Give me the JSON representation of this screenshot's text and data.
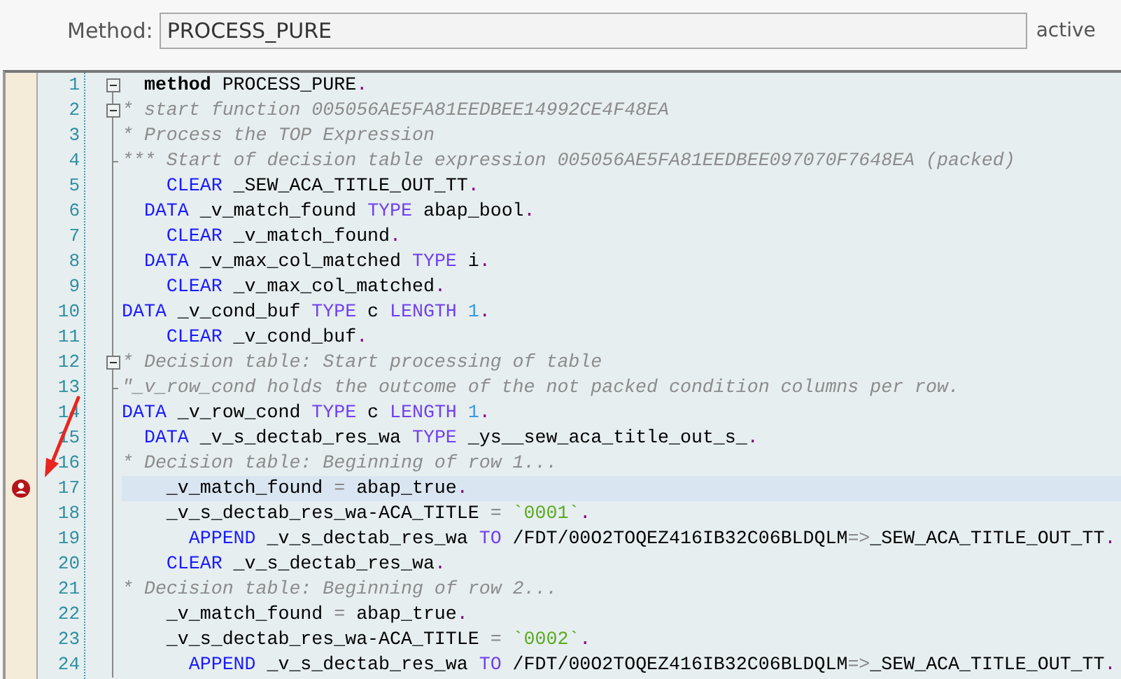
{
  "header": {
    "label": "Method:",
    "value": "PROCESS_PURE",
    "status": "active"
  },
  "lines": [
    {
      "number": "1",
      "collapsible": true,
      "block_end": false,
      "current": false,
      "breakpoint": false,
      "tokens": [
        {
          "kind": "bold",
          "t": "  method"
        },
        {
          "kind": "plain",
          "t": " PROCESS_PURE"
        },
        {
          "kind": "dot",
          "t": "."
        }
      ]
    },
    {
      "number": "2",
      "collapsible": true,
      "block_end": false,
      "current": false,
      "breakpoint": false,
      "tokens": [
        {
          "kind": "comment",
          "t": "* start function 005056AE5FA81EEDBEE14992CE4F48EA"
        }
      ]
    },
    {
      "number": "3",
      "collapsible": false,
      "block_end": false,
      "current": false,
      "breakpoint": false,
      "tokens": [
        {
          "kind": "comment",
          "t": "* Process the TOP Expression"
        }
      ]
    },
    {
      "number": "4",
      "collapsible": false,
      "block_end": true,
      "current": false,
      "breakpoint": false,
      "tokens": [
        {
          "kind": "comment",
          "t": "*** Start of decision table expression 005056AE5FA81EEDBEE097070F7648EA (packed)"
        }
      ]
    },
    {
      "number": "5",
      "collapsible": false,
      "block_end": false,
      "current": false,
      "breakpoint": false,
      "tokens": [
        {
          "kind": "keyword",
          "t": "    CLEAR"
        },
        {
          "kind": "plain",
          "t": " _SEW_ACA_TITLE_OUT_TT"
        },
        {
          "kind": "dot",
          "t": "."
        }
      ]
    },
    {
      "number": "6",
      "collapsible": false,
      "block_end": false,
      "current": false,
      "breakpoint": false,
      "tokens": [
        {
          "kind": "keyword",
          "t": "  DATA"
        },
        {
          "kind": "plain",
          "t": " _v_match_found "
        },
        {
          "kind": "addition",
          "t": "TYPE"
        },
        {
          "kind": "plain",
          "t": " abap_bool"
        },
        {
          "kind": "dot",
          "t": "."
        }
      ]
    },
    {
      "number": "7",
      "collapsible": false,
      "block_end": false,
      "current": false,
      "breakpoint": false,
      "tokens": [
        {
          "kind": "keyword",
          "t": "    CLEAR"
        },
        {
          "kind": "plain",
          "t": " _v_match_found"
        },
        {
          "kind": "dot",
          "t": "."
        }
      ]
    },
    {
      "number": "8",
      "collapsible": false,
      "block_end": false,
      "current": false,
      "breakpoint": false,
      "tokens": [
        {
          "kind": "keyword",
          "t": "  DATA"
        },
        {
          "kind": "plain",
          "t": " _v_max_col_matched "
        },
        {
          "kind": "addition",
          "t": "TYPE"
        },
        {
          "kind": "plain",
          "t": " i"
        },
        {
          "kind": "dot",
          "t": "."
        }
      ]
    },
    {
      "number": "9",
      "collapsible": false,
      "block_end": false,
      "current": false,
      "breakpoint": false,
      "tokens": [
        {
          "kind": "keyword",
          "t": "    CLEAR"
        },
        {
          "kind": "plain",
          "t": " _v_max_col_matched"
        },
        {
          "kind": "dot",
          "t": "."
        }
      ]
    },
    {
      "number": "10",
      "collapsible": false,
      "block_end": false,
      "current": false,
      "breakpoint": false,
      "tokens": [
        {
          "kind": "keyword",
          "t": "DATA"
        },
        {
          "kind": "plain",
          "t": " _v_cond_buf "
        },
        {
          "kind": "addition",
          "t": "TYPE"
        },
        {
          "kind": "plain",
          "t": " c "
        },
        {
          "kind": "addition",
          "t": "LENGTH"
        },
        {
          "kind": "number",
          "t": " 1"
        },
        {
          "kind": "dot",
          "t": "."
        }
      ]
    },
    {
      "number": "11",
      "collapsible": false,
      "block_end": false,
      "current": false,
      "breakpoint": false,
      "tokens": [
        {
          "kind": "keyword",
          "t": "    CLEAR"
        },
        {
          "kind": "plain",
          "t": " _v_cond_buf"
        },
        {
          "kind": "dot",
          "t": "."
        }
      ]
    },
    {
      "number": "12",
      "collapsible": true,
      "block_end": false,
      "current": false,
      "breakpoint": false,
      "tokens": [
        {
          "kind": "comment",
          "t": "* Decision table: Start processing of table"
        }
      ]
    },
    {
      "number": "13",
      "collapsible": false,
      "block_end": true,
      "current": false,
      "breakpoint": false,
      "tokens": [
        {
          "kind": "comment",
          "t": "\"_v_row_cond holds the outcome of the not packed condition columns per row."
        }
      ]
    },
    {
      "number": "14",
      "collapsible": false,
      "block_end": false,
      "current": false,
      "breakpoint": false,
      "tokens": [
        {
          "kind": "keyword",
          "t": "DATA"
        },
        {
          "kind": "plain",
          "t": " _v_row_cond "
        },
        {
          "kind": "addition",
          "t": "TYPE"
        },
        {
          "kind": "plain",
          "t": " c "
        },
        {
          "kind": "addition",
          "t": "LENGTH"
        },
        {
          "kind": "number",
          "t": " 1"
        },
        {
          "kind": "dot",
          "t": "."
        }
      ]
    },
    {
      "number": "15",
      "collapsible": false,
      "block_end": false,
      "current": false,
      "breakpoint": false,
      "tokens": [
        {
          "kind": "keyword",
          "t": "  DATA"
        },
        {
          "kind": "plain",
          "t": " _v_s_dectab_res_wa "
        },
        {
          "kind": "addition",
          "t": "TYPE"
        },
        {
          "kind": "plain",
          "t": " _ys__sew_aca_title_out_s_"
        },
        {
          "kind": "dot",
          "t": "."
        }
      ]
    },
    {
      "number": "16",
      "collapsible": false,
      "block_end": false,
      "current": false,
      "breakpoint": false,
      "tokens": [
        {
          "kind": "comment",
          "t": "* Decision table: Beginning of row 1..."
        }
      ]
    },
    {
      "number": "17",
      "collapsible": false,
      "block_end": false,
      "current": true,
      "breakpoint": true,
      "tokens": [
        {
          "kind": "plain",
          "t": "    _v_match_found "
        },
        {
          "kind": "operator",
          "t": "="
        },
        {
          "kind": "plain",
          "t": " abap_true"
        },
        {
          "kind": "dot",
          "t": "."
        }
      ]
    },
    {
      "number": "18",
      "collapsible": false,
      "block_end": false,
      "current": false,
      "breakpoint": false,
      "tokens": [
        {
          "kind": "plain",
          "t": "    _v_s_dectab_res_wa-ACA_TITLE "
        },
        {
          "kind": "operator",
          "t": "="
        },
        {
          "kind": "string",
          "t": " `0001`"
        },
        {
          "kind": "dot",
          "t": "."
        }
      ]
    },
    {
      "number": "19",
      "collapsible": false,
      "block_end": false,
      "current": false,
      "breakpoint": false,
      "tokens": [
        {
          "kind": "keyword",
          "t": "      APPEND"
        },
        {
          "kind": "plain",
          "t": " _v_s_dectab_res_wa "
        },
        {
          "kind": "addition",
          "t": "TO"
        },
        {
          "kind": "plain",
          "t": " /FDT/00O2TOQEZ416IB32C06BLDQLM"
        },
        {
          "kind": "operator",
          "t": "=>"
        },
        {
          "kind": "plain",
          "t": "_SEW_ACA_TITLE_OUT_TT"
        },
        {
          "kind": "dot",
          "t": "."
        }
      ]
    },
    {
      "number": "20",
      "collapsible": false,
      "block_end": false,
      "current": false,
      "breakpoint": false,
      "tokens": [
        {
          "kind": "keyword",
          "t": "    CLEAR"
        },
        {
          "kind": "plain",
          "t": " _v_s_dectab_res_wa"
        },
        {
          "kind": "dot",
          "t": "."
        }
      ]
    },
    {
      "number": "21",
      "collapsible": false,
      "block_end": false,
      "current": false,
      "breakpoint": false,
      "tokens": [
        {
          "kind": "comment",
          "t": "* Decision table: Beginning of row 2..."
        }
      ]
    },
    {
      "number": "22",
      "collapsible": false,
      "block_end": false,
      "current": false,
      "breakpoint": false,
      "tokens": [
        {
          "kind": "plain",
          "t": "    _v_match_found "
        },
        {
          "kind": "operator",
          "t": "="
        },
        {
          "kind": "plain",
          "t": " abap_true"
        },
        {
          "kind": "dot",
          "t": "."
        }
      ]
    },
    {
      "number": "23",
      "collapsible": false,
      "block_end": false,
      "current": false,
      "breakpoint": false,
      "tokens": [
        {
          "kind": "plain",
          "t": "    _v_s_dectab_res_wa-ACA_TITLE "
        },
        {
          "kind": "operator",
          "t": "="
        },
        {
          "kind": "string",
          "t": " `0002`"
        },
        {
          "kind": "dot",
          "t": "."
        }
      ]
    },
    {
      "number": "24",
      "collapsible": false,
      "block_end": false,
      "current": false,
      "breakpoint": false,
      "tokens": [
        {
          "kind": "keyword",
          "t": "      APPEND"
        },
        {
          "kind": "plain",
          "t": " _v_s_dectab_res_wa "
        },
        {
          "kind": "addition",
          "t": "TO"
        },
        {
          "kind": "plain",
          "t": " /FDT/00O2TOQEZ416IB32C06BLDQLM"
        },
        {
          "kind": "operator",
          "t": "=>"
        },
        {
          "kind": "plain",
          "t": "_SEW_ACA_TITLE_OUT_TT"
        },
        {
          "kind": "dot",
          "t": "."
        }
      ]
    }
  ]
}
